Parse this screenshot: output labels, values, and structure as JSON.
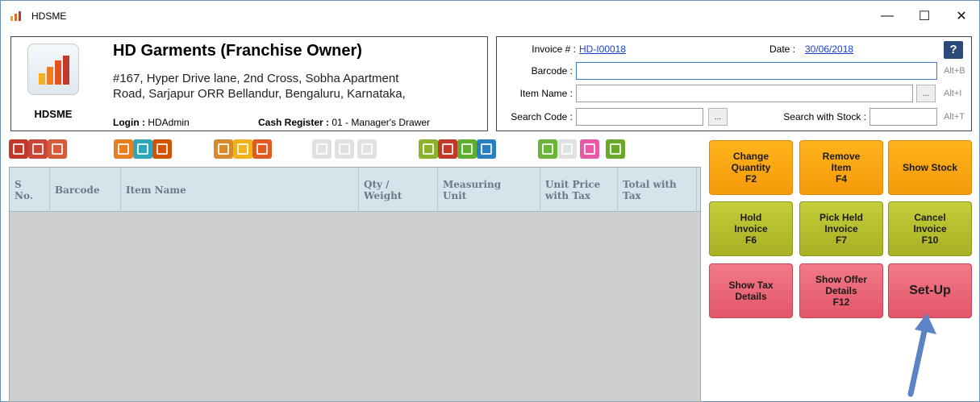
{
  "window": {
    "title": "HDSME",
    "minimize": "—",
    "maximize": "☐",
    "close": "✕"
  },
  "company": {
    "logo_caption": "HDSME",
    "name": "HD Garments (Franchise Owner)",
    "address_line1": "#167, Hyper Drive lane, 2nd Cross, Sobha Apartment",
    "address_line2": "Road, Sarjapur ORR Bellandur, Bengaluru, Karnataka,",
    "login_label": "Login :",
    "login_value": "HDAdmin",
    "cash_register_label": "Cash Register :",
    "cash_register_value": "01 - Manager's Drawer"
  },
  "invoice": {
    "invoice_label": "Invoice # :",
    "invoice_value": "HD-I00018",
    "date_label": "Date :",
    "date_value": "30/06/2018",
    "help": "?",
    "barcode_label": "Barcode :",
    "barcode_value": "",
    "barcode_hotkey": "Alt+B",
    "item_name_label": "Item Name :",
    "item_name_value": "",
    "item_name_hotkey": "Alt+I",
    "search_code_label": "Search Code :",
    "search_code_value": "",
    "search_stock_label": "Search with Stock :",
    "search_stock_value": "",
    "search_stock_hotkey": "Alt+T",
    "browse": "..."
  },
  "toolbar": {
    "icons": [
      {
        "name": "customer-icon",
        "color": "#c0392b"
      },
      {
        "name": "customer-add-icon",
        "color": "#c9463a"
      },
      {
        "name": "customer-export-icon",
        "color": "#d65b3b"
      },
      {
        "name": "notes-edit-icon",
        "color": "#e67e22"
      },
      {
        "name": "cart-icon",
        "color": "#2fa7b8"
      },
      {
        "name": "delivery-icon",
        "color": "#d35400"
      },
      {
        "name": "coupon-icon",
        "color": "#d68a2c"
      },
      {
        "name": "edit-note-icon",
        "color": "#f1b21c"
      },
      {
        "name": "return-icon",
        "color": "#e05a22"
      },
      {
        "name": "checklist-icon",
        "color": "#bdbdbd"
      },
      {
        "name": "disc-icon",
        "color": "#bdbdbd"
      },
      {
        "name": "clear-icon",
        "color": "#bdbdbd"
      },
      {
        "name": "calculator-icon",
        "color": "#8ab22a"
      },
      {
        "name": "currency-notes-icon",
        "color": "#c0392b"
      },
      {
        "name": "cash-register-icon",
        "color": "#5fae2e"
      },
      {
        "name": "apps-grid-icon",
        "color": "#2a7fc1"
      },
      {
        "name": "user-icon",
        "color": "#6bb33a"
      },
      {
        "name": "code-icon",
        "color": "#bdbdbd"
      },
      {
        "name": "key-icon",
        "color": "#e85aa8"
      },
      {
        "name": "settings-gear-icon",
        "color": "#6aa82a"
      }
    ]
  },
  "table": {
    "headers": [
      {
        "key": "sno",
        "label": "S\nNo."
      },
      {
        "key": "barcode",
        "label": "Barcode"
      },
      {
        "key": "item_name",
        "label": "Item Name"
      },
      {
        "key": "qty",
        "label": "Qty /\nWeight"
      },
      {
        "key": "unit",
        "label": "Measuring\nUnit"
      },
      {
        "key": "price",
        "label": "Unit Price\nwith Tax"
      },
      {
        "key": "total",
        "label": "Total with\nTax"
      }
    ],
    "rows": []
  },
  "actions": {
    "change_quantity": "Change\nQuantity\nF2",
    "remove_item": "Remove\nItem\nF4",
    "show_stock": "Show Stock",
    "hold_invoice": "Hold\nInvoice\nF6",
    "pick_held_invoice": "Pick Held\nInvoice\nF7",
    "cancel_invoice": "Cancel\nInvoice\nF10",
    "show_tax_details": "Show Tax\nDetails",
    "show_offer_details": "Show Offer\nDetails\nF12",
    "set_up": "Set-Up"
  },
  "colors": {
    "accent_orange": "#f5a20f",
    "accent_olive": "#b7be2d",
    "accent_pink": "#e9616f",
    "arrow_blue": "#5b84c6"
  }
}
